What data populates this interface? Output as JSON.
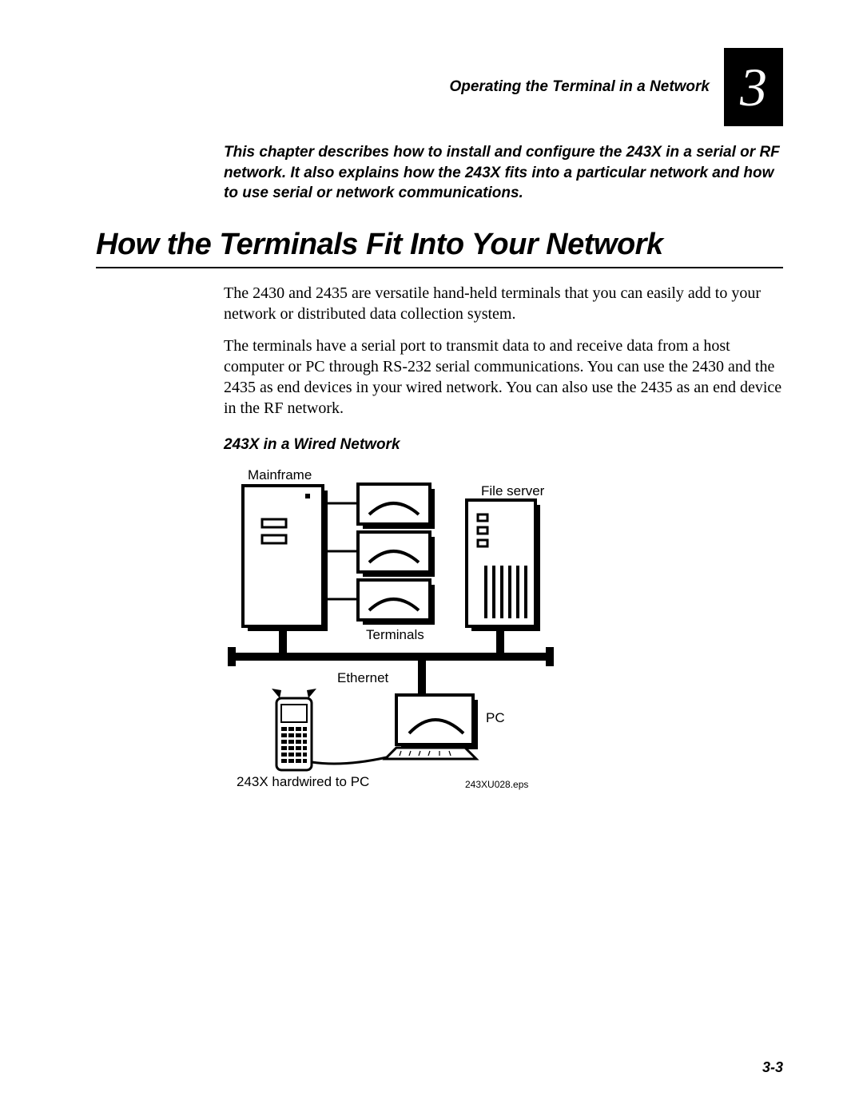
{
  "header": {
    "running_title": "Operating the Terminal in a Network",
    "chapter_number": "3"
  },
  "intro_paragraph": "This chapter describes how to install and configure the 243X in a serial or RF network. It also explains how the 243X fits into a particular network and how to use serial or network communications.",
  "section_title": "How the Terminals Fit Into Your Network",
  "body": {
    "p1": "The 2430 and 2435 are versatile hand-held terminals that you can easily add to your network or distributed data collection system.",
    "p2": "The terminals have a serial port to transmit data to and receive data from a host computer or PC through RS-232 serial communications. You can use the 2430 and the 2435 as end devices in your wired network. You can also use the 2435 as an end device in the RF network."
  },
  "diagram": {
    "title": "243X in a Wired Network",
    "labels": {
      "mainframe": "Mainframe",
      "file_server": "File server",
      "terminals": "Terminals",
      "ethernet": "Ethernet",
      "pc": "PC",
      "handheld": "243X hardwired to PC",
      "eps": "243XU028.eps"
    }
  },
  "page_number": "3-3"
}
